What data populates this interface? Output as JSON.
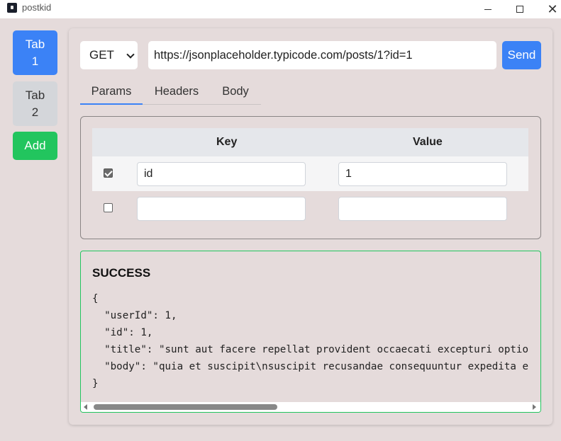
{
  "window": {
    "title": "postkid",
    "minimize": "",
    "maximize": "",
    "close": "✕"
  },
  "sidebar": {
    "tabs": [
      {
        "label_line1": "Tab",
        "label_line2": "1"
      },
      {
        "label_line1": "Tab",
        "label_line2": "2"
      }
    ],
    "add_label": "Add"
  },
  "request": {
    "method": "GET",
    "url": "https://jsonplaceholder.typicode.com/posts/1?id=1",
    "send_label": "Send"
  },
  "subtabs": {
    "params": "Params",
    "headers": "Headers",
    "body": "Body"
  },
  "params_table": {
    "headers": {
      "key": "Key",
      "value": "Value"
    },
    "rows": [
      {
        "checked": true,
        "key": "id",
        "value": "1"
      },
      {
        "checked": false,
        "key": "",
        "value": ""
      }
    ]
  },
  "response": {
    "status": "SUCCESS",
    "lines": [
      "{",
      "  \"userId\": 1,",
      "  \"id\": 1,",
      "  \"title\": \"sunt aut facere repellat provident occaecati excepturi optio",
      "  \"body\": \"quia et suscipit\\nsuscipit recusandae consequuntur expedita e",
      "}"
    ]
  }
}
